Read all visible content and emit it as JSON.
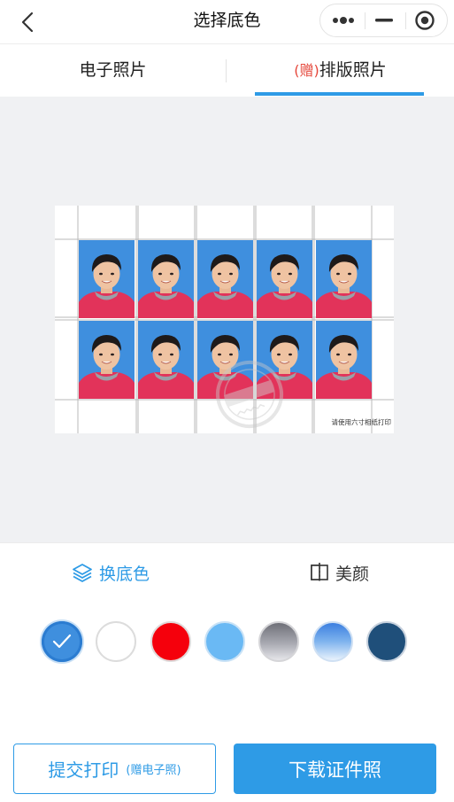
{
  "header": {
    "title": "选择底色",
    "back_icon": "chevron-left-icon",
    "capsule": {
      "more_icon": "more-dots-icon",
      "minimize_icon": "minimize-icon",
      "close_icon": "target-circle-icon"
    }
  },
  "tabs": [
    {
      "label": "电子照片",
      "prefix": "",
      "active": false
    },
    {
      "label": "排版照片",
      "prefix": "(赠)",
      "active": true
    }
  ],
  "preview": {
    "print_note": "请使用六寸相纸打印",
    "photo_count": 10,
    "photo_background": "#3f8fde"
  },
  "tools": {
    "change_bg": {
      "label": "换底色",
      "icon": "layers-icon",
      "active": true
    },
    "beauty": {
      "label": "美颜",
      "icon": "compare-icon",
      "active": false
    }
  },
  "swatches": [
    {
      "name": "blue",
      "color": "#3f8fde",
      "selected": true
    },
    {
      "name": "white",
      "color": "#ffffff",
      "selected": false
    },
    {
      "name": "red",
      "color": "#f5000c",
      "selected": false
    },
    {
      "name": "light-blue",
      "color": "#6ab9f4",
      "selected": false
    },
    {
      "name": "gray-gradient",
      "color": "#8d8e97",
      "selected": false
    },
    {
      "name": "blue-gradient",
      "color": "#5a9ae8",
      "selected": false
    },
    {
      "name": "dark-blue",
      "color": "#1f4f7a",
      "selected": false
    }
  ],
  "actions": {
    "print_label": "提交打印",
    "print_sub": "(赠电子照)",
    "download_label": "下载证件照"
  },
  "colors": {
    "accent": "#2e9be6",
    "gift": "#e5473b"
  }
}
